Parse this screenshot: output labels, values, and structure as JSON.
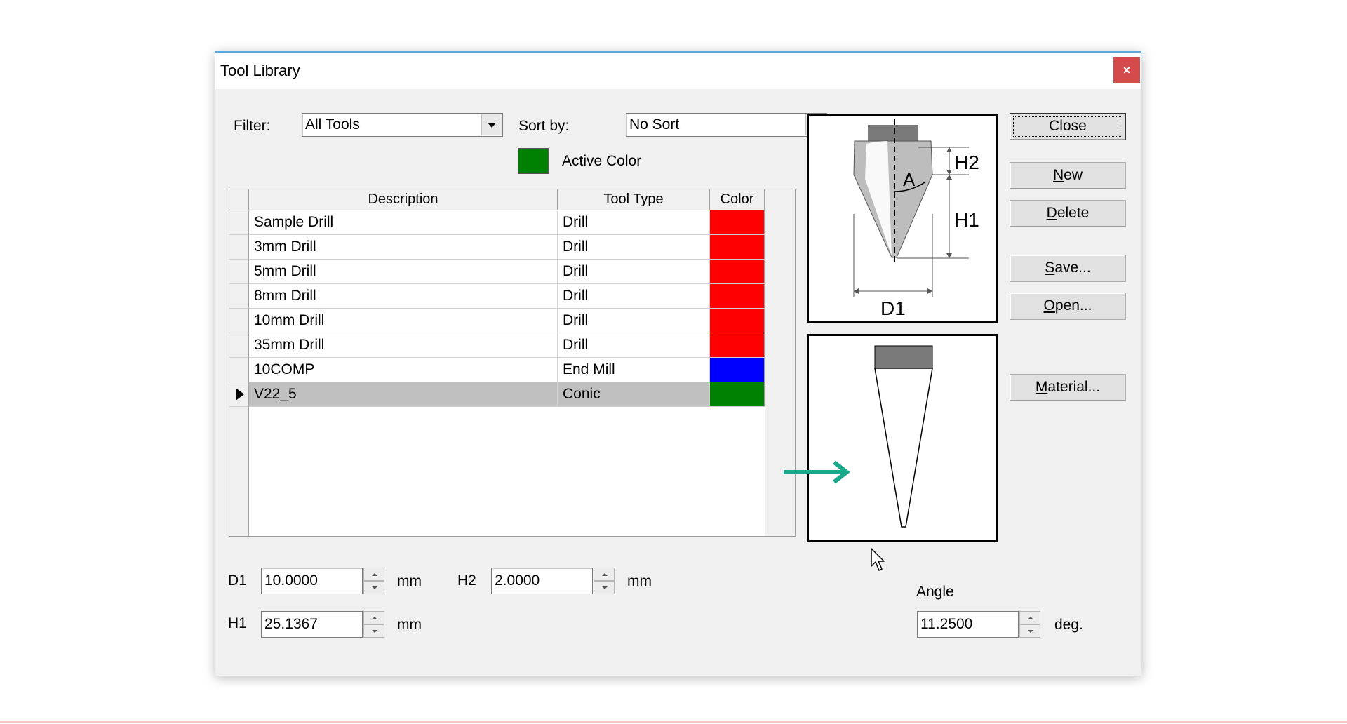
{
  "window": {
    "title": "Tool Library",
    "close_symbol": "×"
  },
  "filter": {
    "label": "Filter:",
    "value": "All Tools"
  },
  "sort": {
    "label": "Sort by:",
    "value": "No Sort"
  },
  "active_color": {
    "label": "Active Color",
    "color": "#008000"
  },
  "table": {
    "headers": [
      "Description",
      "Tool Type",
      "Color"
    ],
    "rows": [
      {
        "description": "Sample Drill",
        "type": "Drill",
        "color": "#ff0000"
      },
      {
        "description": "3mm Drill",
        "type": "Drill",
        "color": "#ff0000"
      },
      {
        "description": "5mm Drill",
        "type": "Drill",
        "color": "#ff0000"
      },
      {
        "description": "8mm Drill",
        "type": "Drill",
        "color": "#ff0000"
      },
      {
        "description": "10mm Drill",
        "type": "Drill",
        "color": "#ff0000"
      },
      {
        "description": "35mm Drill",
        "type": "Drill",
        "color": "#ff0000"
      },
      {
        "description": "10COMP",
        "type": "End Mill",
        "color": "#0000ff"
      },
      {
        "description": "V22_5",
        "type": "Conic",
        "color": "#008000",
        "selected": true
      }
    ]
  },
  "diagram": {
    "h2": "H2",
    "h1": "H1",
    "a": "A",
    "d1": "D1"
  },
  "buttons": {
    "close": "Close",
    "new_u": "N",
    "new_rest": "ew",
    "delete_u": "D",
    "delete_rest": "elete",
    "save_u": "S",
    "save_rest": "ave...",
    "open_u": "O",
    "open_rest": "pen...",
    "material_u": "M",
    "material_rest": "aterial..."
  },
  "params": {
    "d1": {
      "label": "D1",
      "value": "10.0000",
      "unit": "mm"
    },
    "h1": {
      "label": "H1",
      "value": "25.1367",
      "unit": "mm"
    },
    "h2": {
      "label": "H2",
      "value": "2.0000",
      "unit": "mm"
    },
    "angle": {
      "label": "Angle",
      "value": "11.2500",
      "unit": "deg."
    }
  },
  "icons": {
    "dropdown": "chevron-down-icon",
    "row_pointer": "row-pointer-icon",
    "annotation": "arrow-right-icon",
    "cursor": "mouse-cursor-icon"
  }
}
